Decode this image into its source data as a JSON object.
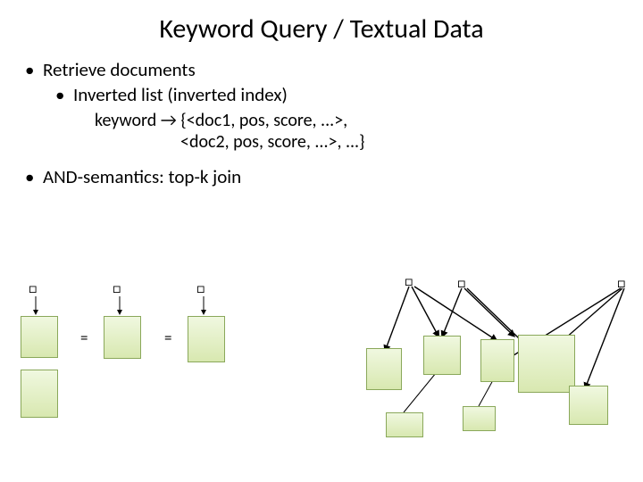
{
  "title": "Keyword Query / Textual Data",
  "bullets": {
    "b1": "Retrieve documents",
    "b2": "Inverted list (inverted index)",
    "sub1": "keyword → {<doc1, pos, score, ...>,",
    "sub2": "<doc2, pos, score, ...>, ...}",
    "b3": "AND-semantics: top-k join"
  },
  "equals": "=",
  "dot": "•",
  "marker": "□"
}
